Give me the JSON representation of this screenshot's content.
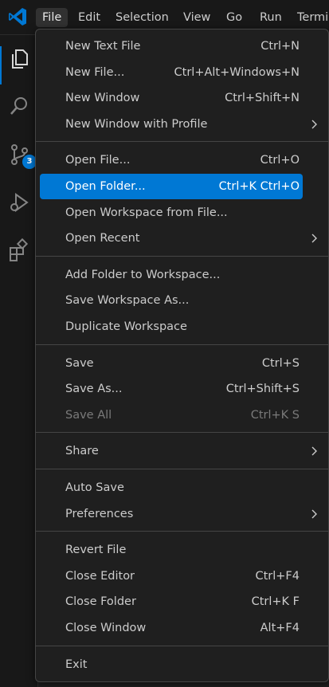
{
  "menubar": {
    "items": [
      "File",
      "Edit",
      "Selection",
      "View",
      "Go",
      "Run",
      "Termi"
    ],
    "active_index": 0
  },
  "activity_bar": {
    "icons": [
      "explorer-icon",
      "search-icon",
      "source-control-icon",
      "run-debug-icon",
      "extensions-icon"
    ],
    "source_control_badge": "3"
  },
  "file_menu": {
    "groups": [
      [
        {
          "label": "New Text File",
          "shortcut": "Ctrl+N"
        },
        {
          "label": "New File...",
          "shortcut": "Ctrl+Alt+Windows+N"
        },
        {
          "label": "New Window",
          "shortcut": "Ctrl+Shift+N"
        },
        {
          "label": "New Window with Profile",
          "submenu": true
        }
      ],
      [
        {
          "label": "Open File...",
          "shortcut": "Ctrl+O"
        },
        {
          "label": "Open Folder...",
          "shortcut": "Ctrl+K Ctrl+O",
          "highlighted": true
        },
        {
          "label": "Open Workspace from File..."
        },
        {
          "label": "Open Recent",
          "submenu": true
        }
      ],
      [
        {
          "label": "Add Folder to Workspace..."
        },
        {
          "label": "Save Workspace As..."
        },
        {
          "label": "Duplicate Workspace"
        }
      ],
      [
        {
          "label": "Save",
          "shortcut": "Ctrl+S"
        },
        {
          "label": "Save As...",
          "shortcut": "Ctrl+Shift+S"
        },
        {
          "label": "Save All",
          "shortcut": "Ctrl+K S",
          "disabled": true
        }
      ],
      [
        {
          "label": "Share",
          "submenu": true
        }
      ],
      [
        {
          "label": "Auto Save"
        },
        {
          "label": "Preferences",
          "submenu": true
        }
      ],
      [
        {
          "label": "Revert File"
        },
        {
          "label": "Close Editor",
          "shortcut": "Ctrl+F4"
        },
        {
          "label": "Close Folder",
          "shortcut": "Ctrl+K F"
        },
        {
          "label": "Close Window",
          "shortcut": "Alt+F4"
        }
      ],
      [
        {
          "label": "Exit"
        }
      ]
    ]
  },
  "colors": {
    "accent": "#0078d4",
    "background": "#1f1f1f",
    "menu_border": "#454545",
    "text": "#cccccc",
    "disabled_text": "#7a7a7a"
  }
}
